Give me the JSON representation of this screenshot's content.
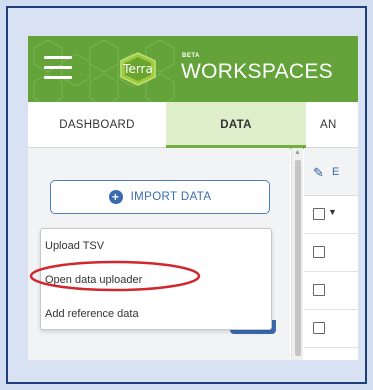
{
  "header": {
    "logo_text": "Terra",
    "beta_badge": "BETA",
    "title": "WORKSPACES",
    "menu_icon": "hamburger-menu-icon",
    "brand_color": "#64a33a"
  },
  "tabs": [
    {
      "label": "DASHBOARD",
      "active": false
    },
    {
      "label": "DATA",
      "active": true
    },
    {
      "label": "AN",
      "active": false
    }
  ],
  "import_button": {
    "label": "IMPORT DATA",
    "icon": "plus-circle-icon"
  },
  "import_menu": {
    "items": [
      {
        "label": "Upload TSV"
      },
      {
        "label": "Open data uploader",
        "highlighted": true
      },
      {
        "label": "Add reference data"
      }
    ]
  },
  "table_toolbar": {
    "edit_label": "E",
    "icon": "pencil-icon"
  },
  "highlight_color": "#d0282e",
  "accent_color": "#3a6bb0"
}
